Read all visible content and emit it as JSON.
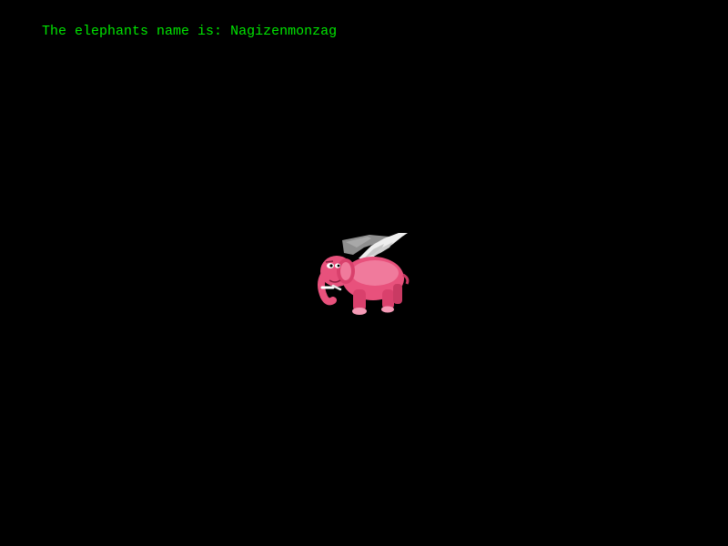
{
  "hud": {
    "label": "The elephants name is: ",
    "elephant_name": "Nagizenmonzag",
    "text_color": "#00e600"
  },
  "sprite": {
    "name": "flying-pink-elephant",
    "body_color": "#e8517c",
    "wing_color": "#d9d9d9"
  },
  "background_color": "#000000"
}
